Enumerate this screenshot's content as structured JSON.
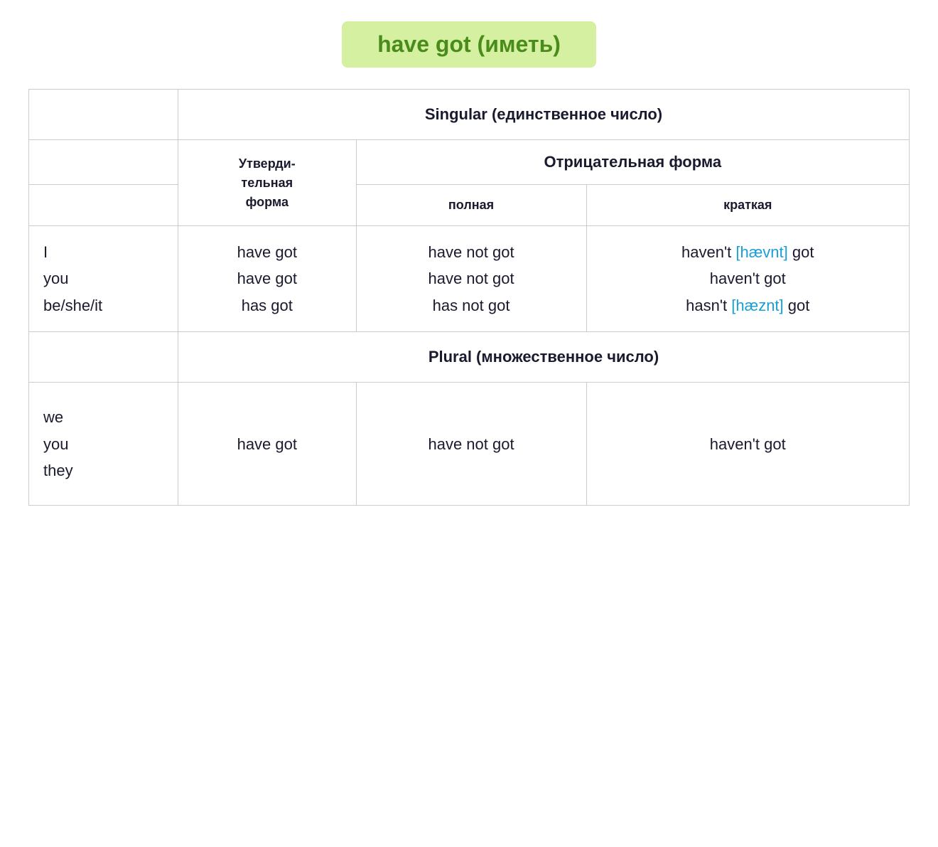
{
  "title": "have got (иметь)",
  "table": {
    "singular_header": "Singular (единственное число)",
    "plural_header": "Plural (множественное число)",
    "affirmative_label": "Утверди-тельная форма",
    "negative_label": "Отрицательная форма",
    "full_label": "полная",
    "short_label": "краткая",
    "singular_row": {
      "pronouns": "I\nyou\nbe/she/it",
      "affirmative": "have got\nhave got\nhas got",
      "negative_full": "have not got\nhave not got\nhas not got",
      "negative_short_line1_pre": "haven't ",
      "negative_short_line1_phonetic": "[hævnt]",
      "negative_short_line1_post": " got",
      "negative_short_line2": "haven't got",
      "negative_short_line3_pre": "hasn't ",
      "negative_short_line3_phonetic": "[hæznt]",
      "negative_short_line3_post": " got"
    },
    "plural_row": {
      "pronouns": "we\nyou\nthey",
      "affirmative": "have got",
      "negative_full": "have not got",
      "negative_short": "haven't got"
    }
  }
}
